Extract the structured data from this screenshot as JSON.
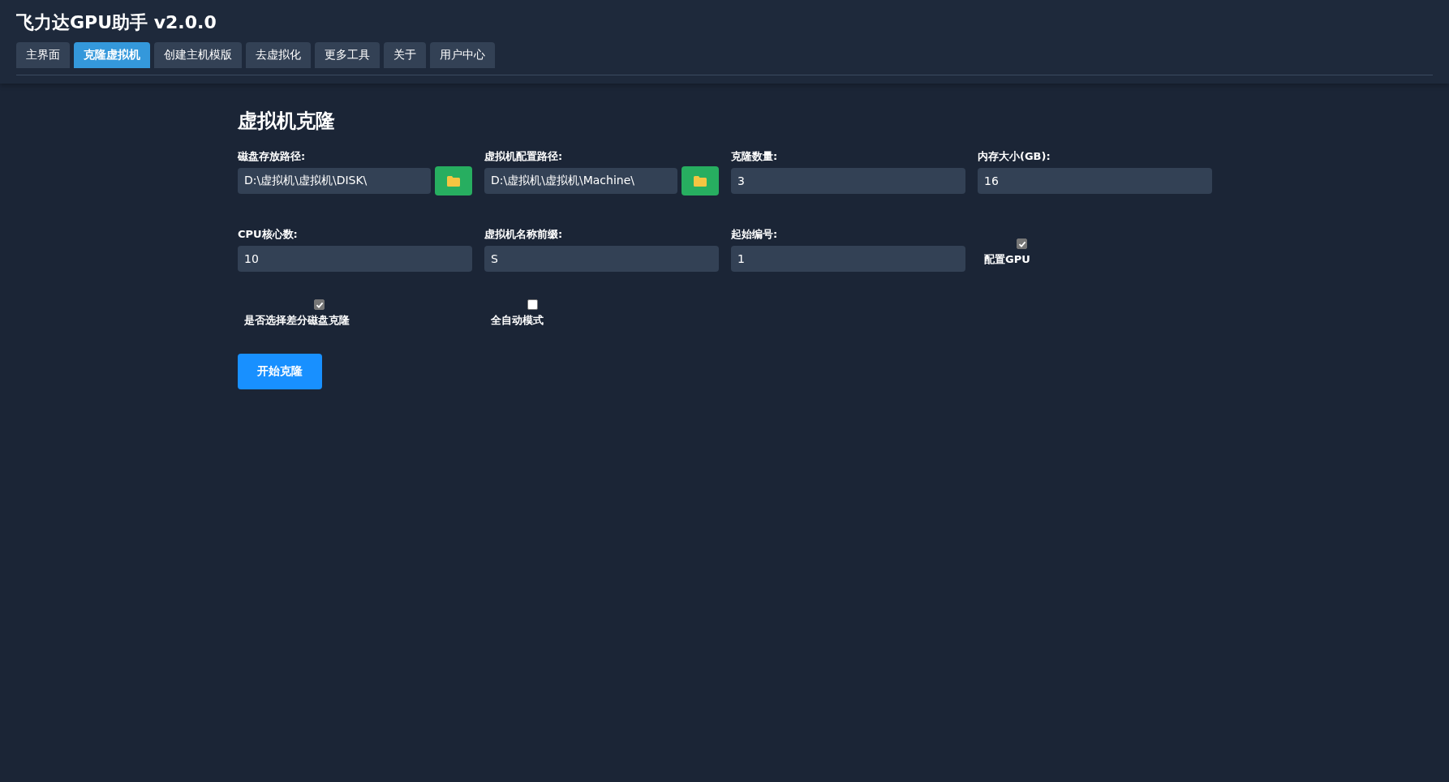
{
  "app": {
    "title": "飞力达GPU助手 v2.0.0"
  },
  "tabs": [
    {
      "label": "主界面",
      "selected": false
    },
    {
      "label": "克隆虚拟机",
      "selected": true
    },
    {
      "label": "创建主机模版",
      "selected": false
    },
    {
      "label": "去虚拟化",
      "selected": false
    },
    {
      "label": "更多工具",
      "selected": false
    },
    {
      "label": "关于",
      "selected": false
    },
    {
      "label": "用户中心",
      "selected": false
    }
  ],
  "form": {
    "title": "虚拟机克隆",
    "fields": [
      {
        "kind": "path",
        "label": "磁盘存放路径:",
        "value": "D:\\虚拟机\\虚拟机\\DISK\\"
      },
      {
        "kind": "path",
        "label": "虚拟机配置路径:",
        "value": "D:\\虚拟机\\虚拟机\\Machine\\"
      },
      {
        "kind": "text",
        "label": "克隆数量:",
        "value": "3"
      },
      {
        "kind": "text",
        "label": "内存大小(GB):",
        "value": "16"
      },
      {
        "kind": "text",
        "label": "CPU核心数:",
        "value": "10"
      },
      {
        "kind": "text",
        "label": "虚拟机名称前缀:",
        "value": "S"
      },
      {
        "kind": "text",
        "label": "起始编号:",
        "value": "1"
      },
      {
        "kind": "checkbox",
        "label": "配置GPU",
        "checked": true
      }
    ],
    "options": [
      {
        "label": "是否选择差分磁盘克隆",
        "checked": true
      },
      {
        "label": "全自动模式",
        "checked": false
      }
    ],
    "button": "开始克隆"
  }
}
